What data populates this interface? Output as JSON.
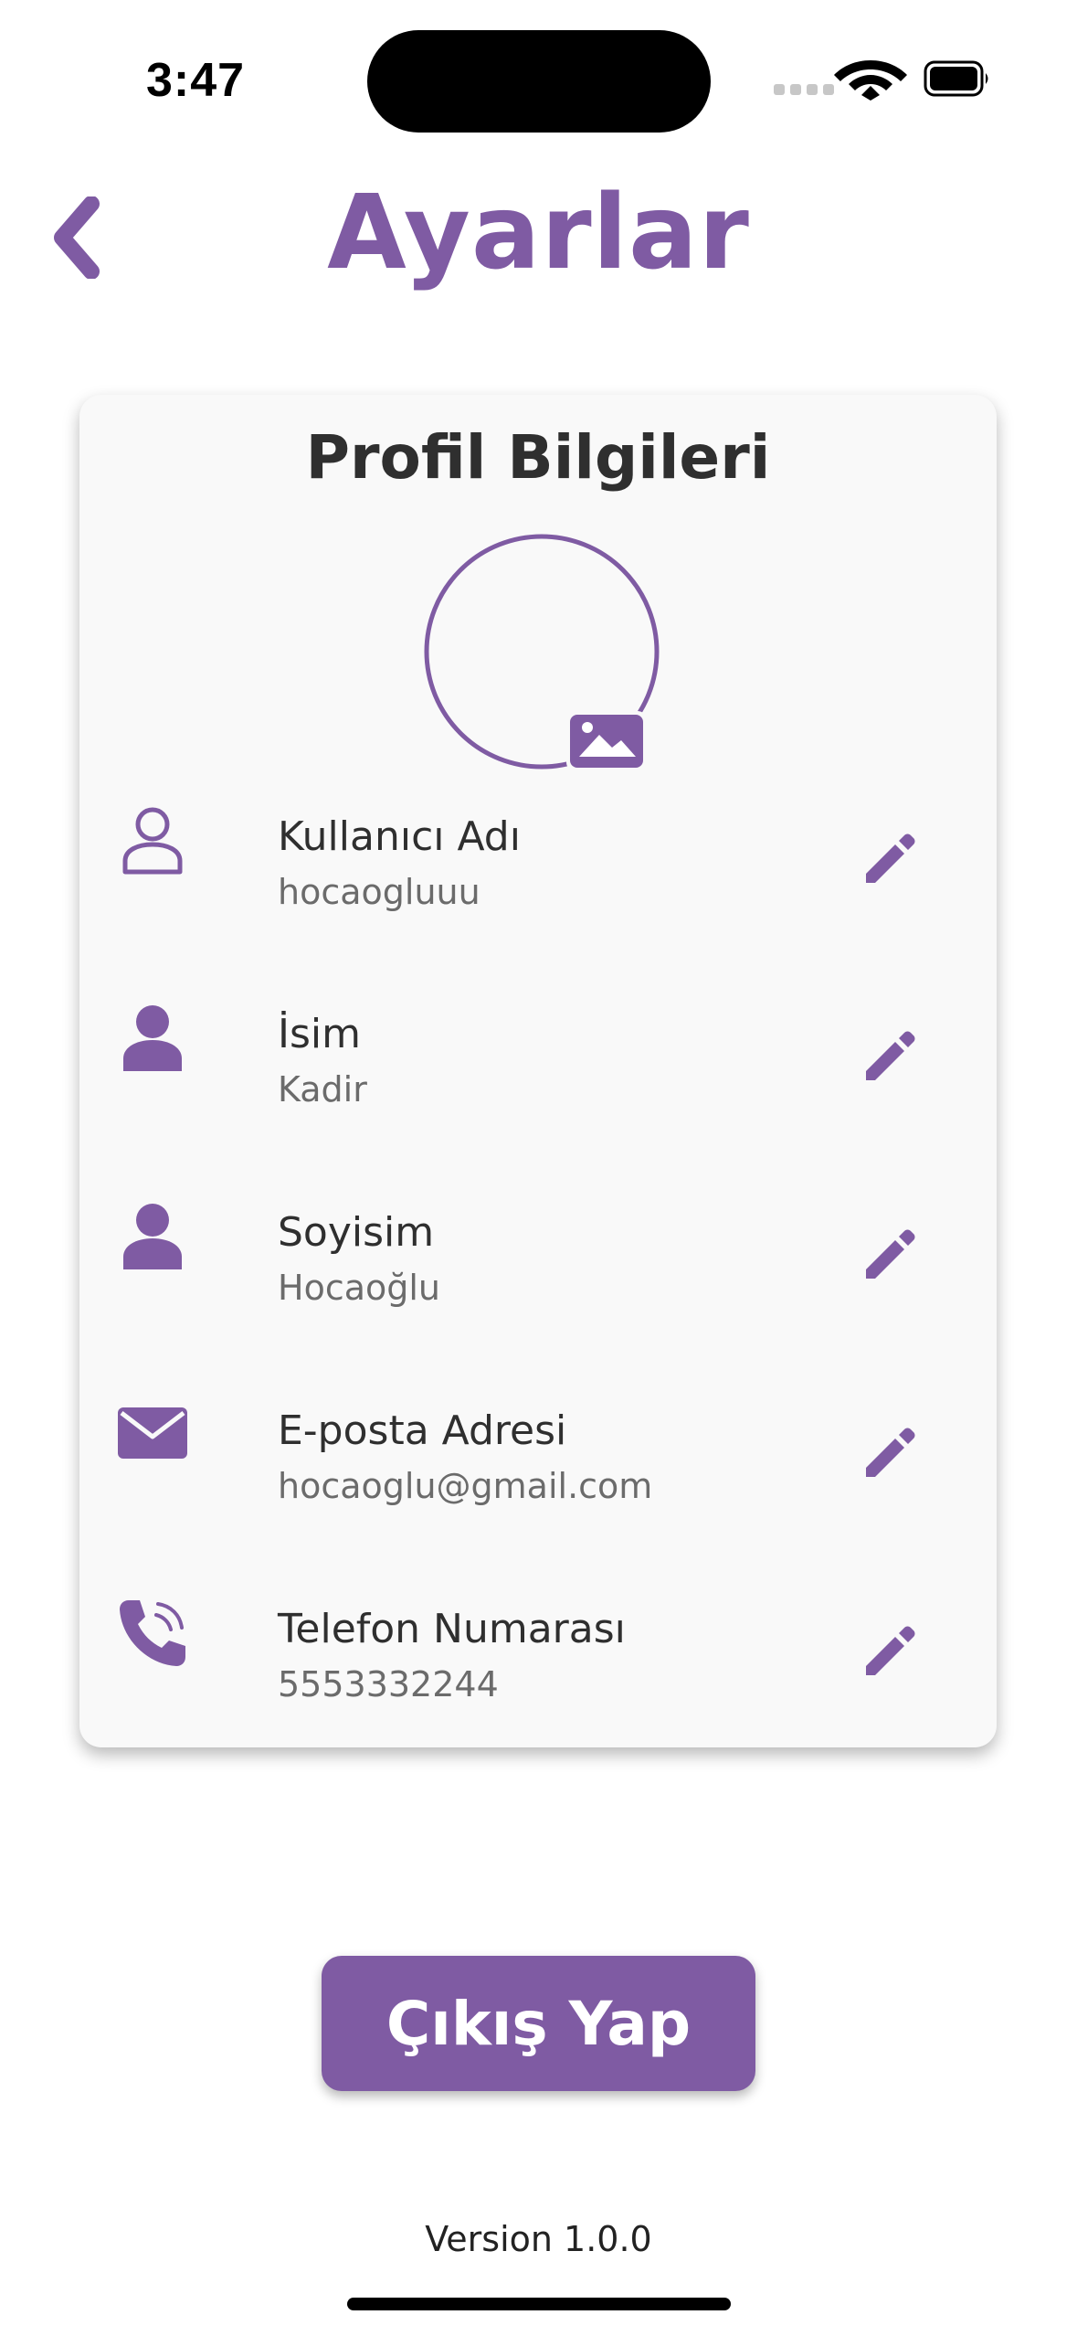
{
  "status_bar": {
    "time": "3:47"
  },
  "header": {
    "title": "Ayarlar",
    "back_icon": "chevron-left-icon"
  },
  "profile_card": {
    "title": "Profil Bilgileri",
    "avatar_icon": "image-icon",
    "fields": [
      {
        "label": "Kullanıcı Adı",
        "value": "hocaogluuu",
        "icon": "person-outline-icon"
      },
      {
        "label": "İsim",
        "value": "Kadir",
        "icon": "person-icon"
      },
      {
        "label": "Soyisim",
        "value": "Hocaoğlu",
        "icon": "person-icon"
      },
      {
        "label": "E-posta Adresi",
        "value": "hocaoglu@gmail.com",
        "icon": "mail-icon"
      },
      {
        "label": "Telefon Numarası",
        "value": "5553332244",
        "icon": "phone-icon"
      }
    ],
    "edit_icon": "pencil-icon"
  },
  "logout": {
    "label": "Çıkış Yap"
  },
  "footer": {
    "version": "Version 1.0.0"
  },
  "colors": {
    "accent": "#7f5ba3",
    "card_background": "#f9f9f9",
    "text_primary": "#2f2f2f",
    "text_secondary": "#6b6b6b"
  }
}
